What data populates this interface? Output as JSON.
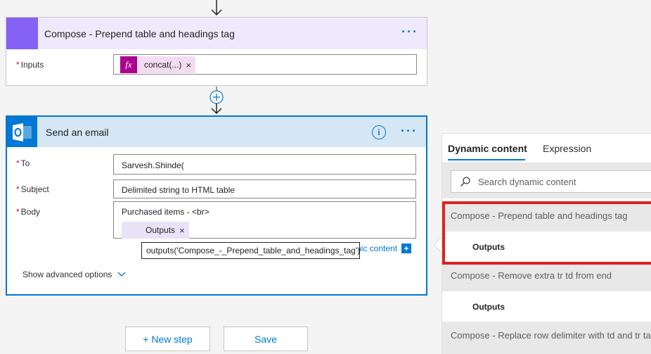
{
  "compose": {
    "title": "Compose - Prepend table and headings tag",
    "more": "···",
    "inputs_label": "Inputs",
    "required_mark": "*",
    "token_label": "concat(...)",
    "token_remove": "×",
    "icon": "compose-icon"
  },
  "email": {
    "title": "Send an email",
    "more": "···",
    "info": "i",
    "icon": "outlook-icon",
    "to_label": "To",
    "to_value": "Sarvesh.Shinde(",
    "subject_label": "Subject",
    "subject_value": "Delimited string to HTML table",
    "body_label": "Body",
    "body_text": "Purchased items - <br>",
    "body_token": "Outputs",
    "body_token_remove": "×",
    "dynamic_link": "nic content",
    "dynamic_link_plus": "+",
    "show_advanced": "Show advanced options",
    "required_mark": "*"
  },
  "tooltip": "outputs('Compose_-_Prepend_table_and_headings_tag')",
  "buttons": {
    "new_step": "+ New step",
    "save": "Save"
  },
  "dynamic_panel": {
    "tabs": [
      "Dynamic content",
      "Expression"
    ],
    "active_tab": "Dynamic content",
    "search_placeholder": "Search dynamic content",
    "groups": [
      {
        "heading": "Compose - Prepend table and headings tag",
        "item": "Outputs",
        "highlighted": true
      },
      {
        "heading": "Compose - Remove extra tr td from end",
        "item": "Outputs",
        "highlighted": false
      },
      {
        "heading": "Compose - Replace row delimiter with td and tr ta",
        "item": "",
        "highlighted": false
      }
    ]
  },
  "colors": {
    "accent": "#0078d4",
    "compose": "#8661f5",
    "expression": "#ad008c",
    "highlight": "#dd2222"
  }
}
